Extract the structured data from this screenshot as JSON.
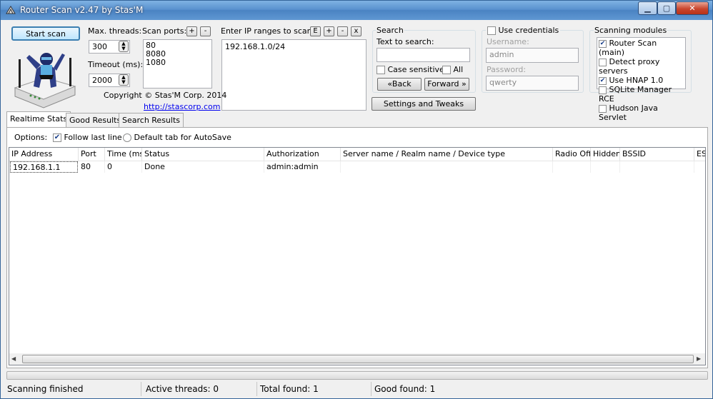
{
  "window": {
    "title": "Router Scan v2.47 by Stas'M"
  },
  "controls": {
    "start_scan": "Start scan",
    "max_threads_label": "Max. threads:",
    "max_threads": "300",
    "timeout_label": "Timeout (ms):",
    "timeout": "2000",
    "scan_ports_label": "Scan ports:",
    "ports": [
      "80",
      "8080",
      "1080"
    ],
    "ip_ranges_label": "Enter IP ranges to scan:",
    "ip_ranges": [
      "192.168.1.0/24"
    ],
    "range_buttons": [
      "E",
      "+",
      "-",
      "x"
    ],
    "port_buttons": [
      "+",
      "-"
    ],
    "copyright": "Copyright © Stas'M Corp. 2014",
    "link": "http://stascorp.com"
  },
  "search": {
    "group_label": "Search",
    "text_label": "Text to search:",
    "value": "",
    "case_sensitive": "Case sensitive",
    "all": "All",
    "back": "«Back",
    "forward": "Forward »",
    "settings": "Settings and Tweaks"
  },
  "credentials": {
    "use_label": "Use credentials",
    "username_label": "Username:",
    "username": "admin",
    "password_label": "Password:",
    "password": "qwerty"
  },
  "modules": {
    "group_label": "Scanning modules",
    "items": [
      {
        "label": "Router Scan (main)",
        "checked": true
      },
      {
        "label": "Detect proxy servers",
        "checked": false
      },
      {
        "label": "Use HNAP 1.0",
        "checked": true
      },
      {
        "label": "SQLite Manager RCE",
        "checked": false
      },
      {
        "label": "Hudson Java Servlet",
        "checked": false
      }
    ]
  },
  "tabs": [
    "Realtime Stats",
    "Good Results",
    "Search Results"
  ],
  "options": {
    "label": "Options:",
    "follow_last_line": "Follow last line",
    "default_tab": "Default tab for AutoSave"
  },
  "table": {
    "columns": [
      "IP Address",
      "Port",
      "Time (ms)",
      "Status",
      "Authorization",
      "Server name / Realm name / Device type",
      "Radio Off",
      "Hidden",
      "BSSID",
      "ESSID"
    ],
    "rows": [
      [
        "192.168.1.1",
        "80",
        "0",
        "Done",
        "admin:admin",
        "",
        "",
        "",
        "",
        ""
      ]
    ]
  },
  "statusbar": {
    "state": "Scanning finished",
    "active_threads": "Active threads: 0",
    "total_found": "Total found: 1",
    "good_found": "Good found: 1"
  }
}
